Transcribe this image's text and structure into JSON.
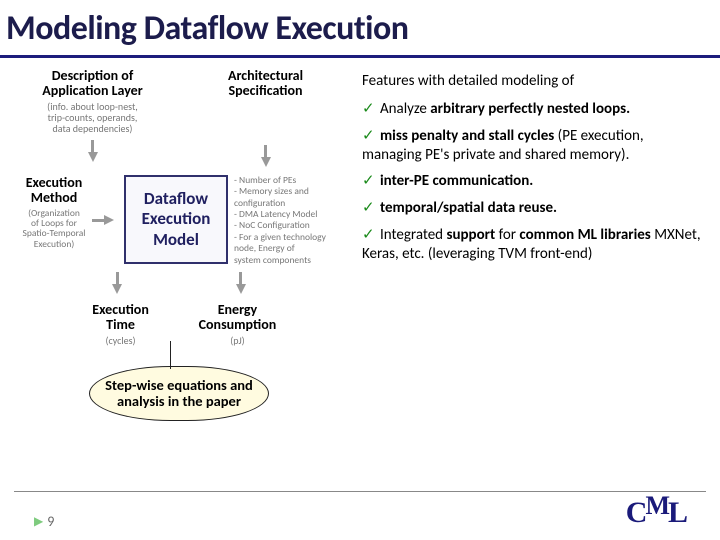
{
  "title": "Modeling Dataflow Execution",
  "diagram": {
    "top_left": {
      "title": "Description of\nApplication Layer",
      "sub": "(info. about loop-nest,\ntrip-counts, operands,\ndata dependencies)"
    },
    "top_right": {
      "title": "Architectural\nSpecification"
    },
    "mid_left": {
      "title": "Execution\nMethod",
      "sub": "(Organization\nof Loops for\nSpatio-Temporal\nExecution)"
    },
    "model_box": "Dataflow\nExecution\nModel",
    "side_notes": "- Number of PEs\n- Memory sizes and\n  configuration\n- DMA Latency Model\n- NoC Configuration\n- For a given technology\n  node, Energy of\n  system components",
    "bot_left": {
      "title": "Execution\nTime",
      "sub": "(cycles)"
    },
    "bot_right": {
      "title": "Energy\nConsumption",
      "sub": "(pJ)"
    }
  },
  "callout": "Step-wise equations and analysis in the paper",
  "features": {
    "heading": "Features with detailed modeling of",
    "items": [
      {
        "plain": "Analyze ",
        "bold": "arbitrary perfectly nested loops."
      },
      {
        "bold": "miss penalty and stall cycles",
        "plain_after": " (PE execution, managing PE's private and shared memory)."
      },
      {
        "bold": "inter-PE communication."
      },
      {
        "bold": "temporal/spatial data reuse."
      },
      {
        "plain": "Integrated ",
        "bold": "support",
        "plain_mid": " for ",
        "bold2": "common ML libraries",
        "plain_after": " MXNet, Keras, etc. (leveraging TVM front-end)"
      }
    ]
  },
  "page_number": "9",
  "logo": {
    "c": "C",
    "m": "M",
    "l": "L"
  }
}
